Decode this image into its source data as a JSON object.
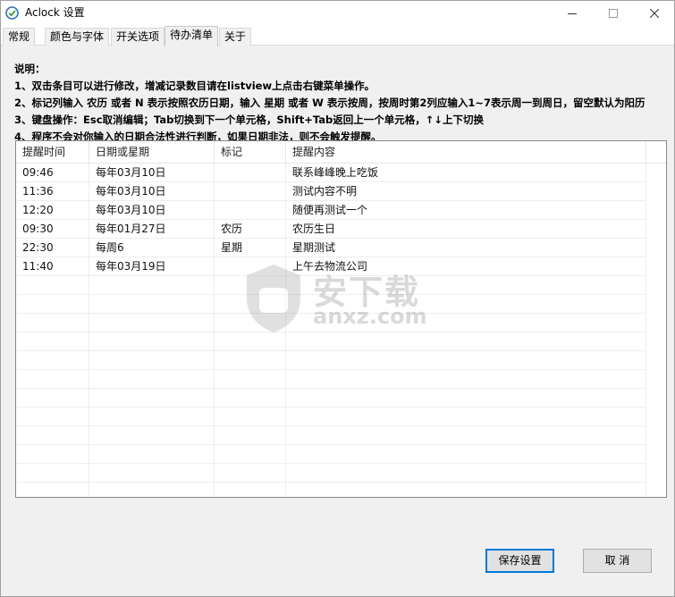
{
  "window": {
    "title": "Aclock 设置",
    "accent_color": "#0078d7"
  },
  "tabs": [
    {
      "label": "常规",
      "active": false
    },
    {
      "label": "颜色与字体",
      "active": false
    },
    {
      "label": "开关选项",
      "active": false
    },
    {
      "label": "待办清单",
      "active": true
    },
    {
      "label": "关于",
      "active": false
    }
  ],
  "instructions": {
    "heading": "说明：",
    "line1": "1、双击条目可以进行修改，增减记录数目请在listview上点击右键菜单操作。",
    "line2": "2、标记列输入 农历 或者 N 表示按照农历日期，输入 星期 或者 W 表示按周，按周时第2列应输入1~7表示周一到周日，留空默认为阳历",
    "line3": "3、键盘操作：Esc取消编辑；Tab切换到下一个单元格，Shift+Tab返回上一个单元格，↑↓上下切换",
    "line4": "4、程序不会对你输入的日期合法性进行判断，如果日期非法，则不会触发提醒。"
  },
  "listview": {
    "columns": [
      "提醒时间",
      "日期或星期",
      "标记",
      "提醒内容"
    ],
    "rows": [
      [
        "09:46",
        "每年03月10日",
        "",
        "联系峰峰晚上吃饭"
      ],
      [
        "11:36",
        "每年03月10日",
        "",
        "测试内容不明"
      ],
      [
        "12:20",
        "每年03月10日",
        "",
        "随便再测试一个"
      ],
      [
        "09:30",
        "每年01月27日",
        "农历",
        "农历生日"
      ],
      [
        "22:30",
        "每周6",
        "星期",
        "星期测试"
      ],
      [
        "11:40",
        "每年03月19日",
        "",
        "上午去物流公司"
      ],
      [
        "",
        "",
        "",
        ""
      ],
      [
        "",
        "",
        "",
        ""
      ],
      [
        "",
        "",
        "",
        ""
      ],
      [
        "",
        "",
        "",
        ""
      ],
      [
        "",
        "",
        "",
        ""
      ],
      [
        "",
        "",
        "",
        ""
      ],
      [
        "",
        "",
        "",
        ""
      ],
      [
        "",
        "",
        "",
        ""
      ],
      [
        "",
        "",
        "",
        ""
      ],
      [
        "",
        "",
        "",
        ""
      ],
      [
        "",
        "",
        "",
        ""
      ],
      [
        "",
        "",
        "",
        ""
      ]
    ]
  },
  "watermark": {
    "text": "安下载",
    "sub": "anxz.com"
  },
  "buttons": {
    "save": "保存设置",
    "cancel": "取 消"
  }
}
